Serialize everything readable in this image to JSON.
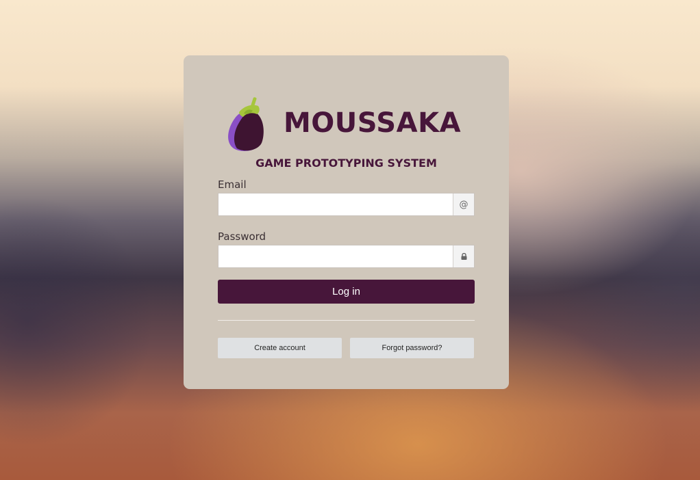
{
  "brand": {
    "app_name": "MOUSSAKA",
    "subtitle": "GAME PROTOTYPING SYSTEM",
    "logo_icon": "eggplant-icon",
    "primary_color": "#47163a"
  },
  "login_form": {
    "email": {
      "label": "Email",
      "value": "",
      "placeholder": "",
      "addon_symbol": "@",
      "addon_icon": "at-icon"
    },
    "password": {
      "label": "Password",
      "value": "",
      "placeholder": "",
      "addon_icon": "lock-icon"
    },
    "login_label": "Log in"
  },
  "secondary_actions": {
    "create_account_label": "Create account",
    "forgot_password_label": "Forgot password?"
  }
}
